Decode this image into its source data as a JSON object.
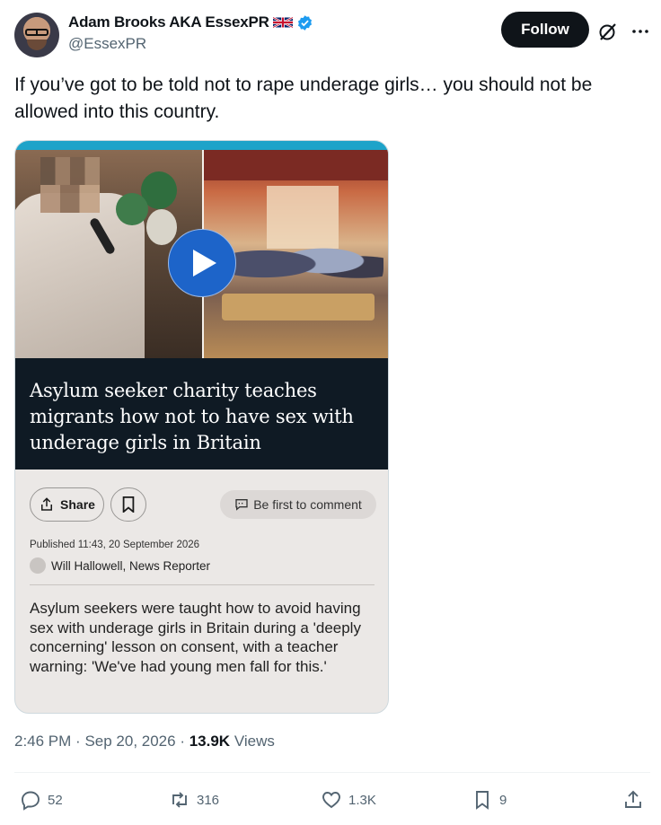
{
  "author": {
    "display_name": "Adam Brooks AKA EssexPR",
    "handle": "@EssexPR",
    "flag_icon": "uk-flag-icon",
    "verified_icon": "verified-badge-icon",
    "verified_color": "#1d9bf0"
  },
  "follow_label": "Follow",
  "tweet_text": "If you’ve got to be told not to rape underage girls… you should not be allowed into this country.",
  "card": {
    "headline": "Asylum seeker charity teaches migrants how not to have sex with underage girls in Britain",
    "share_label": "Share",
    "comment_label": "Be first to comment",
    "published": "Published 11:43, 20 September 2026",
    "author": "Will Hallowell, News Reporter",
    "summary": "Asylum seekers were taught how to avoid having sex with underage girls in Britain during a 'deeply concerning' lesson on consent, with a teacher warning: 'We've had young men fall for this.'"
  },
  "meta": {
    "time": "2:46 PM",
    "date": "Sep 20, 2026",
    "views_count": "13.9K",
    "views_label": "Views"
  },
  "actions": {
    "replies": "52",
    "reposts": "316",
    "likes": "1.3K",
    "bookmarks": "9"
  },
  "colors": {
    "text": "#0f1419",
    "secondary": "#536471",
    "follow_bg": "#0f1419",
    "play_button": "#1d64c9",
    "headline_bg": "#0f1a24"
  }
}
